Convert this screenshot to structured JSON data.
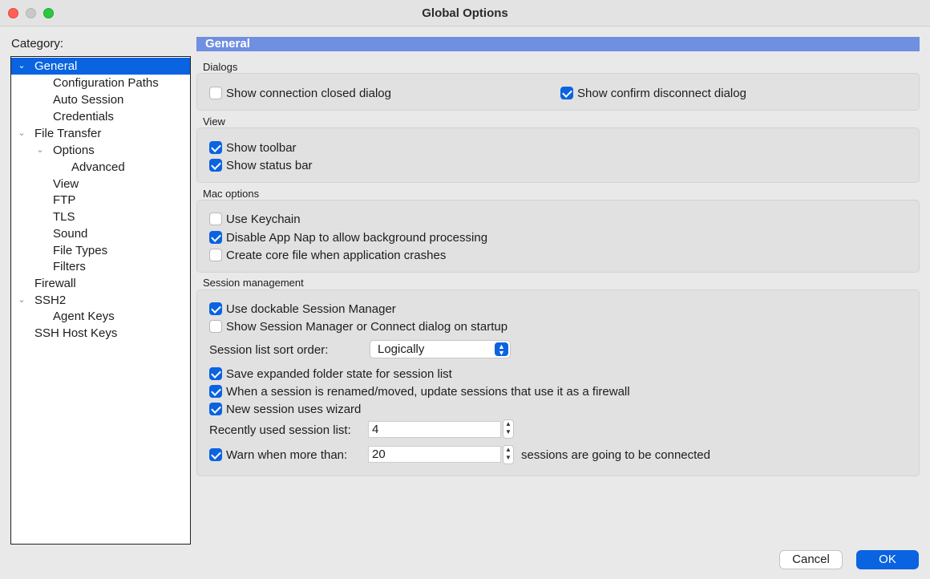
{
  "window": {
    "title": "Global Options"
  },
  "category": {
    "label": "Category:",
    "tree": [
      {
        "label": "General",
        "expanded": true,
        "selected": true
      },
      {
        "label": "Configuration Paths"
      },
      {
        "label": "Auto Session"
      },
      {
        "label": "Credentials"
      },
      {
        "label": "File Transfer",
        "expanded": true
      },
      {
        "label": "Options",
        "expanded": true
      },
      {
        "label": "Advanced"
      },
      {
        "label": "View"
      },
      {
        "label": "FTP"
      },
      {
        "label": "TLS"
      },
      {
        "label": "Sound"
      },
      {
        "label": "File Types"
      },
      {
        "label": "Filters"
      },
      {
        "label": "Firewall"
      },
      {
        "label": "SSH2",
        "expanded": true
      },
      {
        "label": "Agent Keys"
      },
      {
        "label": "SSH Host Keys"
      }
    ]
  },
  "panel": {
    "title": "General"
  },
  "dialogs": {
    "label": "Dialogs",
    "show_connection_closed": {
      "label": "Show connection closed dialog",
      "checked": false
    },
    "show_confirm_disconnect": {
      "label": "Show confirm disconnect dialog",
      "checked": true
    }
  },
  "view": {
    "label": "View",
    "show_toolbar": {
      "label": "Show toolbar",
      "checked": true
    },
    "show_status_bar": {
      "label": "Show status bar",
      "checked": true
    }
  },
  "mac_options": {
    "label": "Mac options",
    "use_keychain": {
      "label": "Use Keychain",
      "checked": false
    },
    "disable_app_nap": {
      "label": "Disable App Nap to allow background processing",
      "checked": true
    },
    "create_core_file": {
      "label": "Create core file when application crashes",
      "checked": false
    }
  },
  "session_management": {
    "label": "Session management",
    "use_dockable": {
      "label": "Use dockable Session Manager",
      "checked": true
    },
    "show_on_startup": {
      "label": "Show Session Manager or Connect dialog on startup",
      "checked": false
    },
    "sort_order_label": "Session list sort order:",
    "sort_order_value": "Logically",
    "save_expanded": {
      "label": "Save expanded folder state for session list",
      "checked": true
    },
    "update_firewall": {
      "label": "When a session is renamed/moved, update sessions that use it as a firewall",
      "checked": true
    },
    "new_session_wizard": {
      "label": "New session uses wizard",
      "checked": true
    },
    "recent_list_label": "Recently used session list:",
    "recent_list_value": "4",
    "warn_label": "Warn when more than:",
    "warn_checked": true,
    "warn_value": "20",
    "warn_suffix": "sessions are going to be connected"
  },
  "buttons": {
    "cancel": "Cancel",
    "ok": "OK"
  },
  "colors": {
    "accent": "#0a63e0",
    "header": "#6f8fe0"
  },
  "icons": {
    "expanded": "chevron-down-icon",
    "stepper": "up-down-arrows-icon"
  }
}
